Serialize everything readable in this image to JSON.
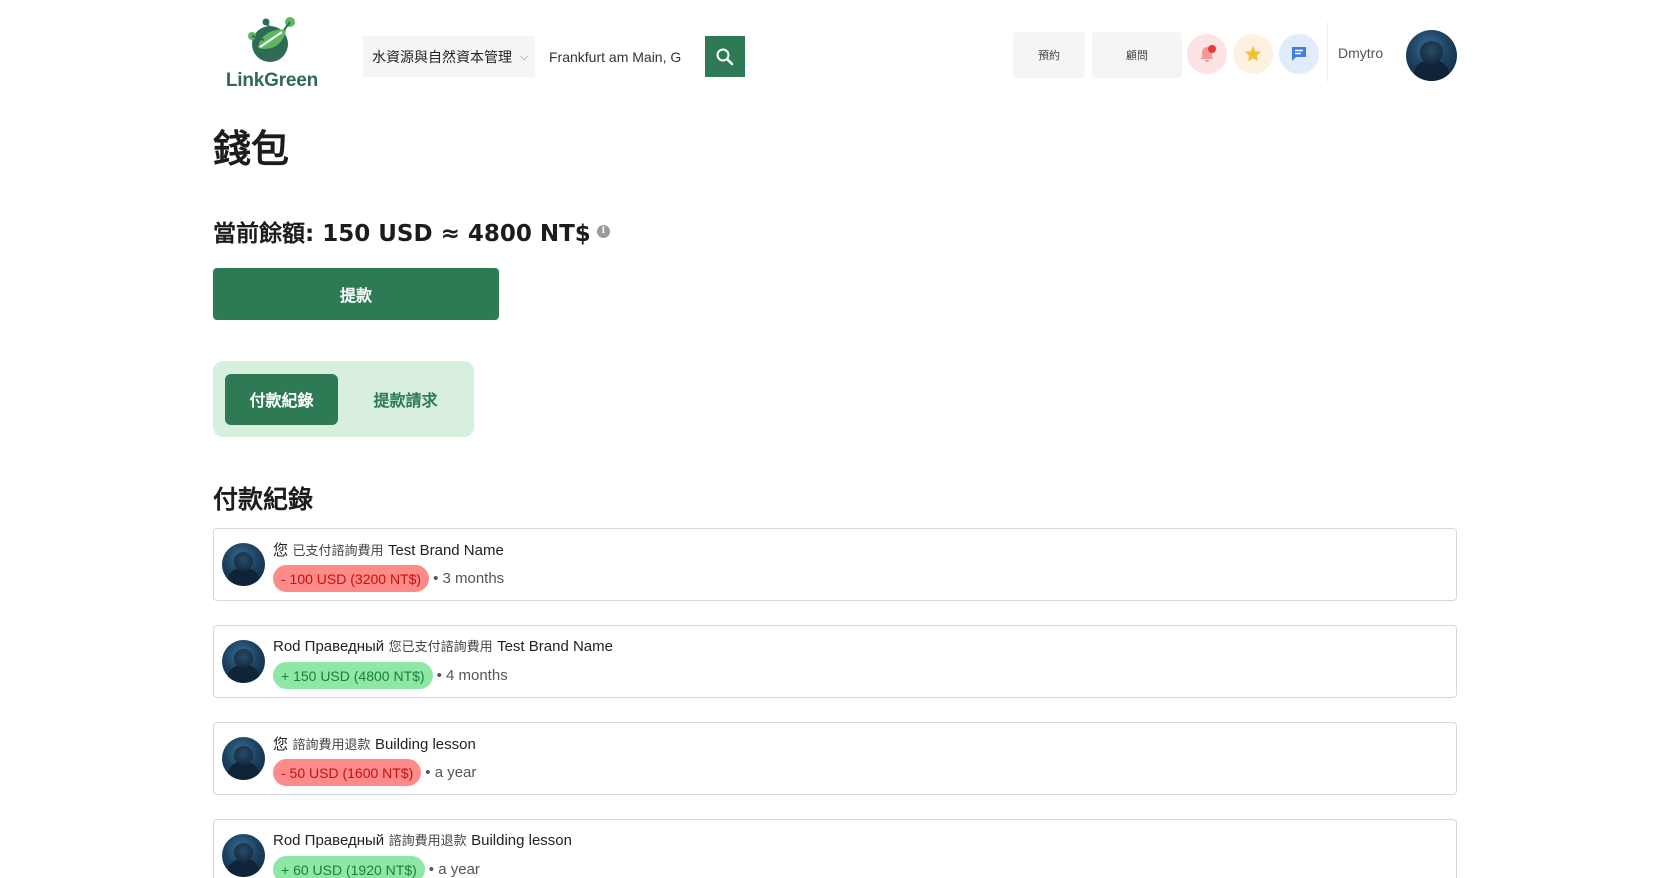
{
  "header": {
    "logo_text": "LinkGreen",
    "search": {
      "category": "水資源與自然資本管理",
      "location": "Frankfurt am Main, G"
    },
    "nav": {
      "booking": "預約",
      "consultant": "顧問"
    },
    "user": {
      "name": "Dmytro"
    }
  },
  "wallet": {
    "title": "錢包",
    "balance_label": "當前餘額: 150 USD ≈ 4800 NT$",
    "info_glyph": "i",
    "withdraw_label": "提款"
  },
  "tabs": [
    {
      "label": "付款紀錄",
      "active": true
    },
    {
      "label": "提款請求",
      "active": false
    }
  ],
  "section_title": "付款紀錄",
  "records": [
    {
      "name": "您",
      "action": "已支付諮詢費用",
      "target": "Test Brand Name",
      "amount": "- 100 USD (3200 NT$)",
      "type": "negative",
      "time": "• 3 months"
    },
    {
      "name": "Rod Праведный",
      "action": "您已支付諮詢費用",
      "target": "Test Brand Name",
      "amount": "+ 150 USD (4800 NT$)",
      "type": "positive",
      "time": "• 4 months"
    },
    {
      "name": "您",
      "action": "諮詢費用退款",
      "target": "Building lesson",
      "amount": "- 50 USD (1600 NT$)",
      "type": "negative",
      "time": "• a year"
    },
    {
      "name": "Rod Праведный",
      "action": "諮詢費用退款",
      "target": "Building lesson",
      "amount": "+ 60 USD (1920 NT$)",
      "type": "positive",
      "time": "• a year"
    }
  ],
  "colors": {
    "brand_green": "#2e7a55",
    "tab_bg": "#d9efdd",
    "negative_bg": "#ff8a8a",
    "positive_bg": "#8fe7a6"
  }
}
